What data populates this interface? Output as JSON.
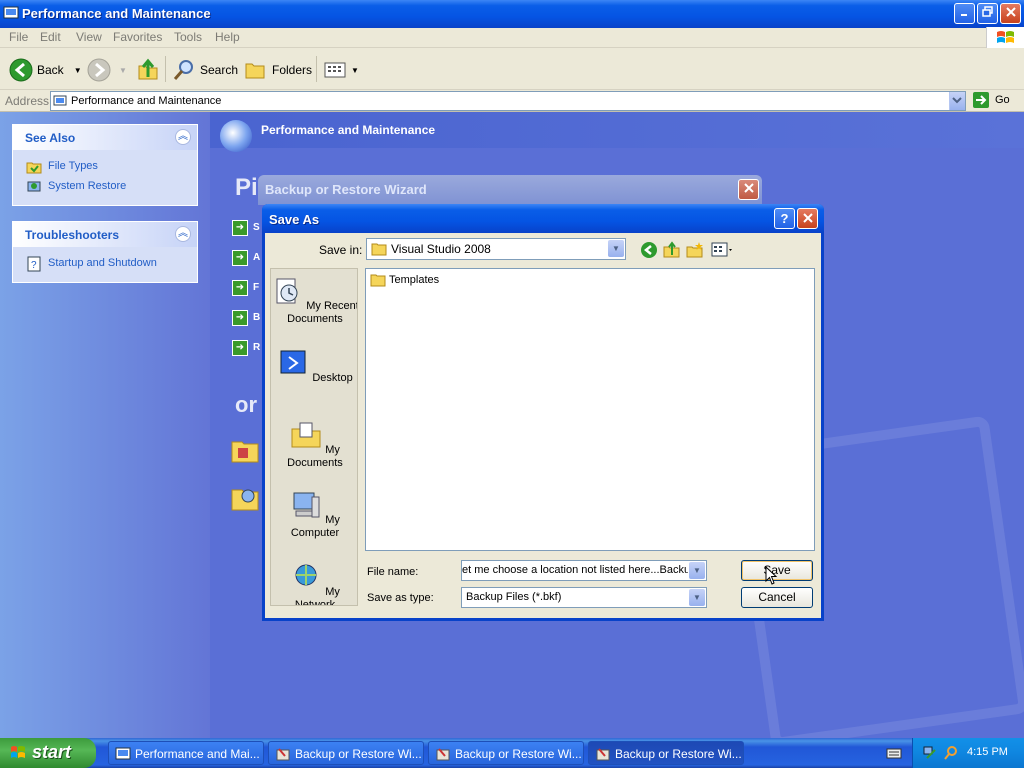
{
  "explorer": {
    "title": "Performance and Maintenance",
    "menu": [
      "File",
      "Edit",
      "View",
      "Favorites",
      "Tools",
      "Help"
    ],
    "toolbar": {
      "back": "Back",
      "search": "Search",
      "folders": "Folders"
    },
    "address": {
      "label": "Address",
      "value": "Performance and Maintenance",
      "go": "Go"
    }
  },
  "taskpane": {
    "see_also": {
      "title": "See Also",
      "items": [
        "File Types",
        "System Restore"
      ]
    },
    "troubleshooters": {
      "title": "Troubleshooters",
      "items": [
        "Startup and Shutdown"
      ]
    }
  },
  "main": {
    "banner_title": "Performance and Maintenance",
    "partial_heading_1": "Pi",
    "partial_heading_2": "or",
    "partial_letters": [
      "S",
      "A",
      "F",
      "B",
      "R"
    ]
  },
  "wizard": {
    "title": "Backup or Restore Wizard"
  },
  "save_as": {
    "title": "Save As",
    "save_in_label": "Save in:",
    "save_in_value": "Visual Studio 2008",
    "places": [
      "My Recent Documents",
      "Desktop",
      "My Documents",
      "My Computer",
      "My Network"
    ],
    "files": [
      "Templates"
    ],
    "file_name_label": "File name:",
    "file_name_value": "et me choose a location not listed here...Backup",
    "save_type_label": "Save as type:",
    "save_type_value": "Backup Files (*.bkf)",
    "save_button": "Save",
    "cancel_button": "Cancel"
  },
  "taskbar": {
    "start": "start",
    "tasks": [
      "Performance and Mai...",
      "Backup or Restore Wi...",
      "Backup or Restore Wi...",
      "Backup or Restore Wi..."
    ],
    "clock": "4:15 PM"
  }
}
